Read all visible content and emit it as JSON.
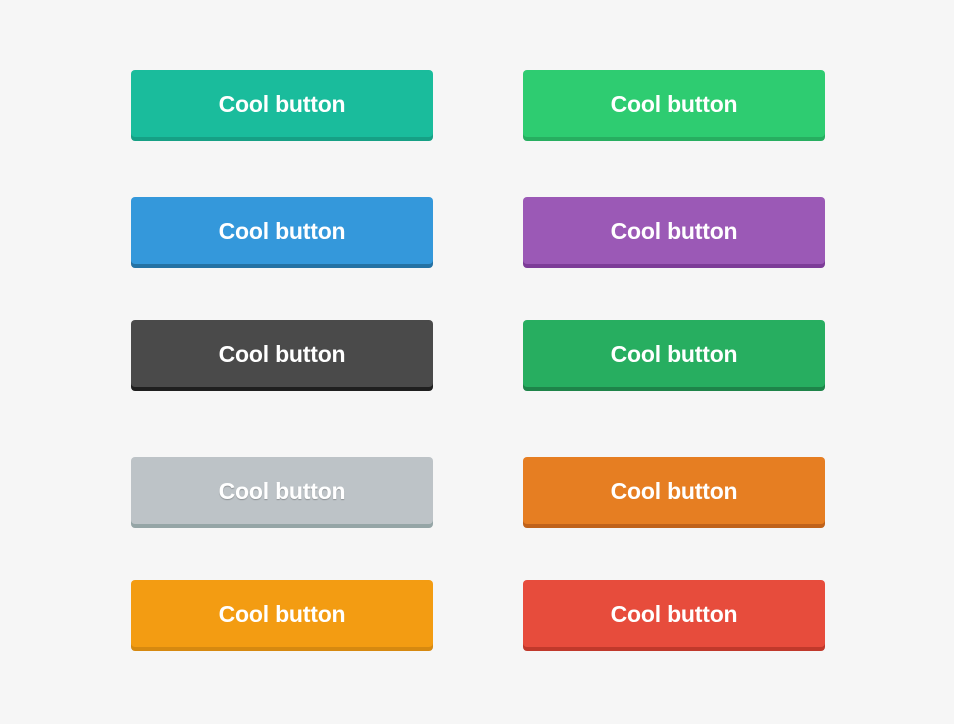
{
  "buttons": [
    {
      "label": "Cool button",
      "color": "#1abc9c",
      "shadow": "#16a085",
      "variant": "turquoise"
    },
    {
      "label": "Cool button",
      "color": "#2ecc71",
      "shadow": "#27ae60",
      "variant": "emerald"
    },
    {
      "label": "Cool button",
      "color": "#3498db",
      "shadow": "#2472a4",
      "variant": "peter-river"
    },
    {
      "label": "Cool button",
      "color": "#9b59b6",
      "shadow": "#7d3c98",
      "variant": "amethyst"
    },
    {
      "label": "Cool button",
      "color": "#4a4a4a",
      "shadow": "#1f1f1f",
      "variant": "dark"
    },
    {
      "label": "Cool button",
      "color": "#27ae60",
      "shadow": "#1e8449",
      "variant": "nephritis"
    },
    {
      "label": "Cool button",
      "color": "#bdc3c7",
      "shadow": "#95a5a6",
      "variant": "silver"
    },
    {
      "label": "Cool button",
      "color": "#e67e22",
      "shadow": "#c0621a",
      "variant": "carrot"
    },
    {
      "label": "Cool button",
      "color": "#f39c12",
      "shadow": "#d68910",
      "variant": "orange"
    },
    {
      "label": "Cool button",
      "color": "#e74c3c",
      "shadow": "#c0392b",
      "variant": "alizarin"
    }
  ]
}
